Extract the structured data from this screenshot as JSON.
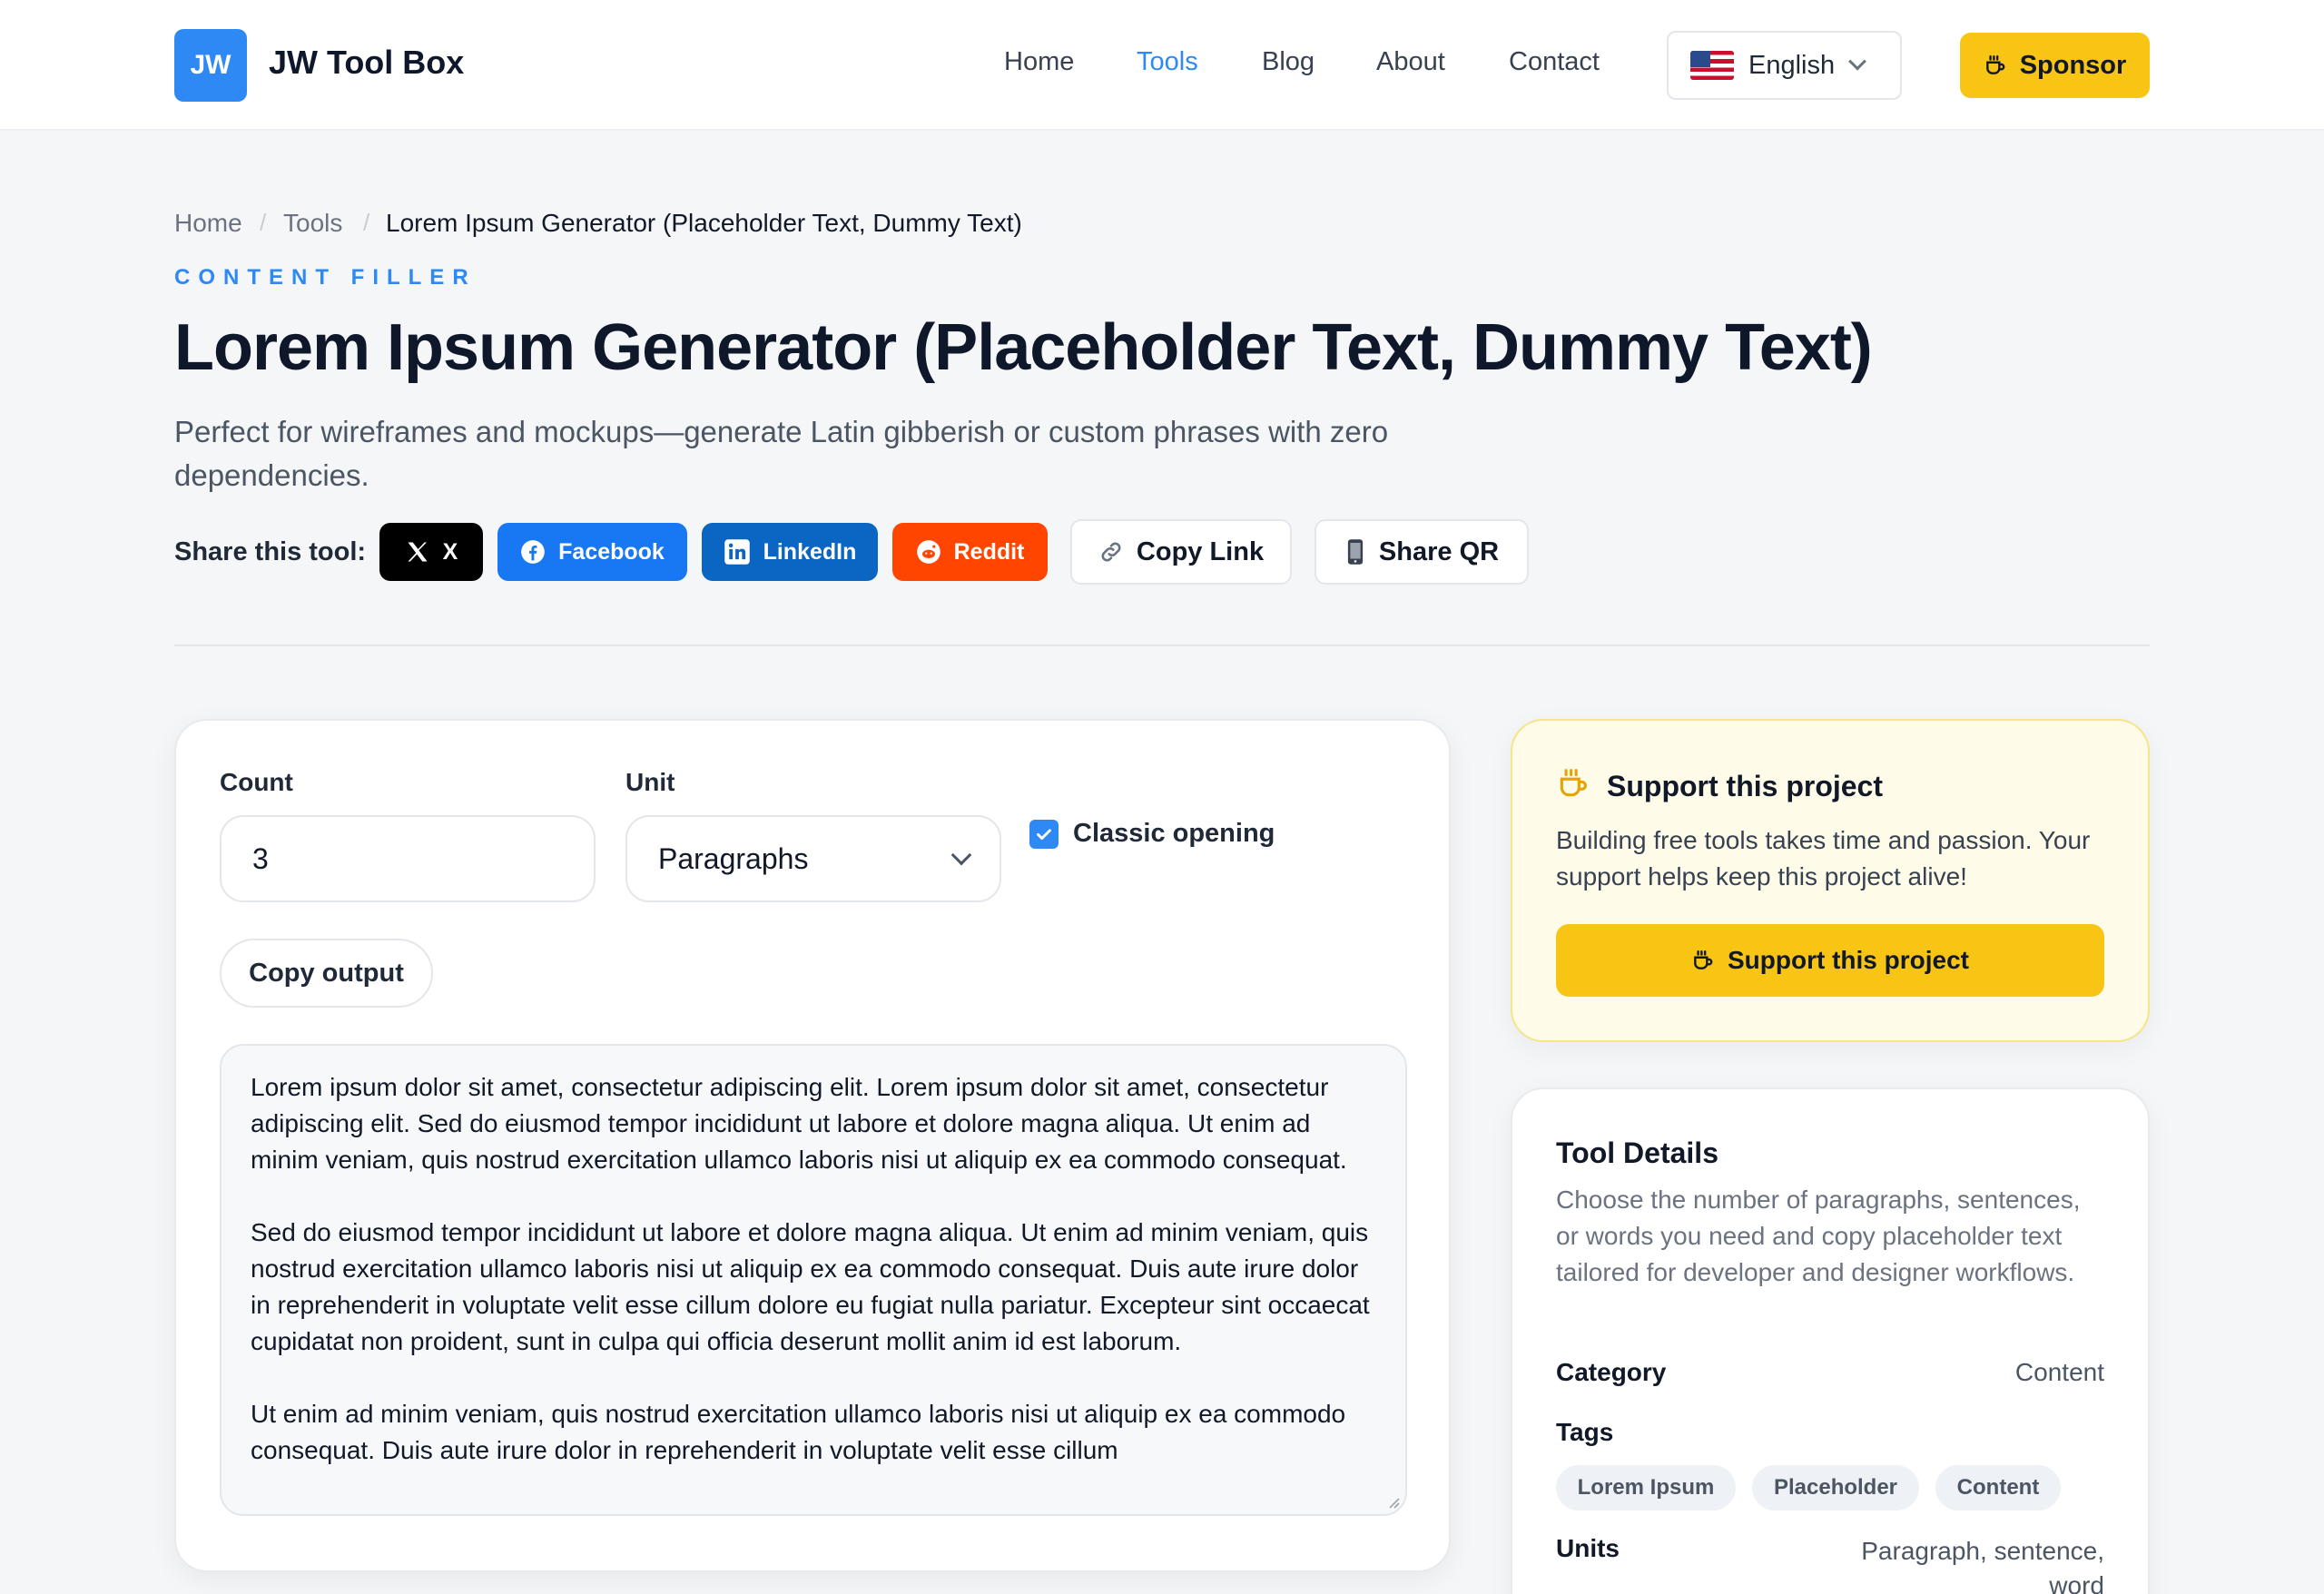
{
  "header": {
    "logo_text": "JW",
    "brand": "JW Tool Box",
    "nav": [
      "Home",
      "Tools",
      "Blog",
      "About",
      "Contact"
    ],
    "active_nav": "Tools",
    "language": "English",
    "sponsor_label": "Sponsor"
  },
  "breadcrumb": {
    "home": "Home",
    "tools": "Tools",
    "current": "Lorem Ipsum Generator (Placeholder Text, Dummy Text)",
    "separator": "/"
  },
  "page": {
    "eyebrow": "CONTENT FILLER",
    "title": "Lorem Ipsum Generator (Placeholder Text, Dummy Text)",
    "subtitle": "Perfect for wireframes and mockups—generate Latin gibberish or custom phrases with zero dependencies."
  },
  "share": {
    "label": "Share this tool:",
    "x": "X",
    "facebook": "Facebook",
    "linkedin": "LinkedIn",
    "reddit": "Reddit",
    "copy_link": "Copy Link",
    "share_qr": "Share QR"
  },
  "generator": {
    "count_label": "Count",
    "count_value": "3",
    "unit_label": "Unit",
    "unit_value": "Paragraphs",
    "classic_label": "Classic opening",
    "classic_checked": true,
    "copy_label": "Copy output",
    "output": [
      "Lorem ipsum dolor sit amet, consectetur adipiscing elit. Lorem ipsum dolor sit amet, consectetur adipiscing elit. Sed do eiusmod tempor incididunt ut labore et dolore magna aliqua. Ut enim ad minim veniam, quis nostrud exercitation ullamco laboris nisi ut aliquip ex ea commodo consequat.",
      "Sed do eiusmod tempor incididunt ut labore et dolore magna aliqua. Ut enim ad minim veniam, quis nostrud exercitation ullamco laboris nisi ut aliquip ex ea commodo consequat. Duis aute irure dolor in reprehenderit in voluptate velit esse cillum dolore eu fugiat nulla pariatur. Excepteur sint occaecat cupidatat non proident, sunt in culpa qui officia deserunt mollit anim id est laborum.",
      "Ut enim ad minim veniam, quis nostrud exercitation ullamco laboris nisi ut aliquip ex ea commodo consequat. Duis aute irure dolor in reprehenderit in voluptate velit esse cillum"
    ]
  },
  "support": {
    "title": "Support this project",
    "description": "Building free tools takes time and passion. Your support helps keep this project alive!",
    "button": "Support this project"
  },
  "details": {
    "title": "Tool Details",
    "description": "Choose the number of paragraphs, sentences, or words you need and copy placeholder text tailored for developer and designer workflows.",
    "category_label": "Category",
    "category_value": "Content",
    "tags_label": "Tags",
    "tags": [
      "Lorem Ipsum",
      "Placeholder",
      "Content"
    ],
    "units_label": "Units",
    "units_value": "Paragraph, sentence, word"
  },
  "colors": {
    "accent": "#2f89f5",
    "sponsor": "#f8c515",
    "x": "#000000",
    "facebook": "#1877f2",
    "linkedin": "#0a66c2",
    "reddit": "#ff4500"
  }
}
